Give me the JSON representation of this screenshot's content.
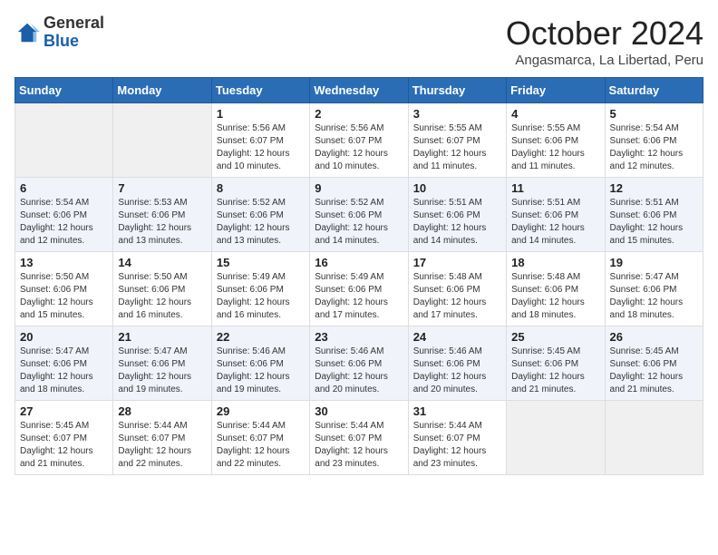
{
  "header": {
    "logo_general": "General",
    "logo_blue": "Blue",
    "month": "October 2024",
    "location": "Angasmarca, La Libertad, Peru"
  },
  "days_of_week": [
    "Sunday",
    "Monday",
    "Tuesday",
    "Wednesday",
    "Thursday",
    "Friday",
    "Saturday"
  ],
  "weeks": [
    [
      {
        "day": "",
        "info": ""
      },
      {
        "day": "",
        "info": ""
      },
      {
        "day": "1",
        "info": "Sunrise: 5:56 AM\nSunset: 6:07 PM\nDaylight: 12 hours and 10 minutes."
      },
      {
        "day": "2",
        "info": "Sunrise: 5:56 AM\nSunset: 6:07 PM\nDaylight: 12 hours and 10 minutes."
      },
      {
        "day": "3",
        "info": "Sunrise: 5:55 AM\nSunset: 6:07 PM\nDaylight: 12 hours and 11 minutes."
      },
      {
        "day": "4",
        "info": "Sunrise: 5:55 AM\nSunset: 6:06 PM\nDaylight: 12 hours and 11 minutes."
      },
      {
        "day": "5",
        "info": "Sunrise: 5:54 AM\nSunset: 6:06 PM\nDaylight: 12 hours and 12 minutes."
      }
    ],
    [
      {
        "day": "6",
        "info": "Sunrise: 5:54 AM\nSunset: 6:06 PM\nDaylight: 12 hours and 12 minutes."
      },
      {
        "day": "7",
        "info": "Sunrise: 5:53 AM\nSunset: 6:06 PM\nDaylight: 12 hours and 13 minutes."
      },
      {
        "day": "8",
        "info": "Sunrise: 5:52 AM\nSunset: 6:06 PM\nDaylight: 12 hours and 13 minutes."
      },
      {
        "day": "9",
        "info": "Sunrise: 5:52 AM\nSunset: 6:06 PM\nDaylight: 12 hours and 14 minutes."
      },
      {
        "day": "10",
        "info": "Sunrise: 5:51 AM\nSunset: 6:06 PM\nDaylight: 12 hours and 14 minutes."
      },
      {
        "day": "11",
        "info": "Sunrise: 5:51 AM\nSunset: 6:06 PM\nDaylight: 12 hours and 14 minutes."
      },
      {
        "day": "12",
        "info": "Sunrise: 5:51 AM\nSunset: 6:06 PM\nDaylight: 12 hours and 15 minutes."
      }
    ],
    [
      {
        "day": "13",
        "info": "Sunrise: 5:50 AM\nSunset: 6:06 PM\nDaylight: 12 hours and 15 minutes."
      },
      {
        "day": "14",
        "info": "Sunrise: 5:50 AM\nSunset: 6:06 PM\nDaylight: 12 hours and 16 minutes."
      },
      {
        "day": "15",
        "info": "Sunrise: 5:49 AM\nSunset: 6:06 PM\nDaylight: 12 hours and 16 minutes."
      },
      {
        "day": "16",
        "info": "Sunrise: 5:49 AM\nSunset: 6:06 PM\nDaylight: 12 hours and 17 minutes."
      },
      {
        "day": "17",
        "info": "Sunrise: 5:48 AM\nSunset: 6:06 PM\nDaylight: 12 hours and 17 minutes."
      },
      {
        "day": "18",
        "info": "Sunrise: 5:48 AM\nSunset: 6:06 PM\nDaylight: 12 hours and 18 minutes."
      },
      {
        "day": "19",
        "info": "Sunrise: 5:47 AM\nSunset: 6:06 PM\nDaylight: 12 hours and 18 minutes."
      }
    ],
    [
      {
        "day": "20",
        "info": "Sunrise: 5:47 AM\nSunset: 6:06 PM\nDaylight: 12 hours and 18 minutes."
      },
      {
        "day": "21",
        "info": "Sunrise: 5:47 AM\nSunset: 6:06 PM\nDaylight: 12 hours and 19 minutes."
      },
      {
        "day": "22",
        "info": "Sunrise: 5:46 AM\nSunset: 6:06 PM\nDaylight: 12 hours and 19 minutes."
      },
      {
        "day": "23",
        "info": "Sunrise: 5:46 AM\nSunset: 6:06 PM\nDaylight: 12 hours and 20 minutes."
      },
      {
        "day": "24",
        "info": "Sunrise: 5:46 AM\nSunset: 6:06 PM\nDaylight: 12 hours and 20 minutes."
      },
      {
        "day": "25",
        "info": "Sunrise: 5:45 AM\nSunset: 6:06 PM\nDaylight: 12 hours and 21 minutes."
      },
      {
        "day": "26",
        "info": "Sunrise: 5:45 AM\nSunset: 6:06 PM\nDaylight: 12 hours and 21 minutes."
      }
    ],
    [
      {
        "day": "27",
        "info": "Sunrise: 5:45 AM\nSunset: 6:07 PM\nDaylight: 12 hours and 21 minutes."
      },
      {
        "day": "28",
        "info": "Sunrise: 5:44 AM\nSunset: 6:07 PM\nDaylight: 12 hours and 22 minutes."
      },
      {
        "day": "29",
        "info": "Sunrise: 5:44 AM\nSunset: 6:07 PM\nDaylight: 12 hours and 22 minutes."
      },
      {
        "day": "30",
        "info": "Sunrise: 5:44 AM\nSunset: 6:07 PM\nDaylight: 12 hours and 23 minutes."
      },
      {
        "day": "31",
        "info": "Sunrise: 5:44 AM\nSunset: 6:07 PM\nDaylight: 12 hours and 23 minutes."
      },
      {
        "day": "",
        "info": ""
      },
      {
        "day": "",
        "info": ""
      }
    ]
  ]
}
